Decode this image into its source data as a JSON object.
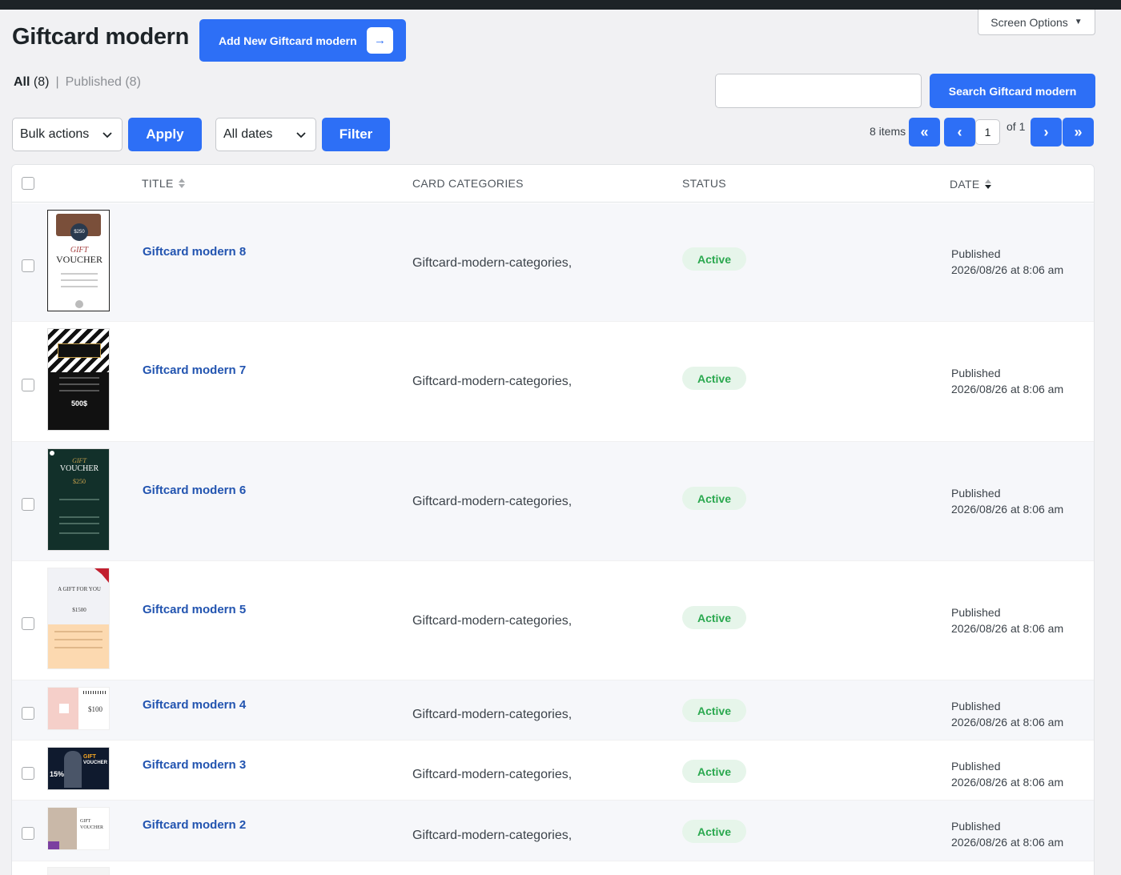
{
  "page": {
    "title": "Giftcard modern",
    "add_new_label": "Add New Giftcard modern",
    "screen_options_label": "Screen Options"
  },
  "views": {
    "all_label": "All",
    "all_count": "(8)",
    "separator": "|",
    "published_label": "Published (8)"
  },
  "search": {
    "value": "",
    "button_label": "Search Giftcard modern"
  },
  "toolbar": {
    "bulk_actions_label": "Bulk actions",
    "apply_label": "Apply",
    "dates_label": "All dates",
    "filter_label": "Filter"
  },
  "pagination": {
    "items_label": "8 items",
    "first": "«",
    "prev": "‹",
    "current_page": "1",
    "of_label": "of 1",
    "next": "›",
    "last": "»"
  },
  "table": {
    "columns": [
      "TITLE",
      "CARD CATEGORIES",
      "STATUS",
      "DATE"
    ],
    "rows": [
      {
        "title": "Giftcard modern 8",
        "category": "Giftcard-modern-categories,",
        "status": "Active",
        "date_status": "Published",
        "date": "2026/08/26 at 8:06 am"
      },
      {
        "title": "Giftcard modern 7",
        "category": "Giftcard-modern-categories,",
        "status": "Active",
        "date_status": "Published",
        "date": "2026/08/26 at 8:06 am"
      },
      {
        "title": "Giftcard modern 6",
        "category": "Giftcard-modern-categories,",
        "status": "Active",
        "date_status": "Published",
        "date": "2026/08/26 at 8:06 am"
      },
      {
        "title": "Giftcard modern 5",
        "category": "Giftcard-modern-categories,",
        "status": "Active",
        "date_status": "Published",
        "date": "2026/08/26 at 8:06 am"
      },
      {
        "title": "Giftcard modern 4",
        "category": "Giftcard-modern-categories,",
        "status": "Active",
        "date_status": "Published",
        "date": "2026/08/26 at 8:06 am"
      },
      {
        "title": "Giftcard modern 3",
        "category": "Giftcard-modern-categories,",
        "status": "Active",
        "date_status": "Published",
        "date": "2026/08/26 at 8:06 am"
      },
      {
        "title": "Giftcard modern 2",
        "category": "Giftcard-modern-categories,",
        "status": "Active",
        "date_status": "Published",
        "date": "2026/08/26 at 8:06 am"
      }
    ]
  },
  "thumbnails": {
    "t8_title": "GIFT",
    "t8_word": "VOUCHER",
    "t8_price": "$250",
    "t7_price": "500$",
    "t6_title": "GIFT",
    "t6_word": "VOUCHER",
    "t6_price": "$250",
    "t5_title": "A GIFT FOR YOU",
    "t5_price": "$1500",
    "t4_price": "$100",
    "t3_pct": "15%",
    "t3_title": "GIFT",
    "t3_word": "VOUCHER",
    "t2_title": "GIFT",
    "t2_word": "VOUCHER"
  },
  "colors": {
    "accent": "#2d6ff6",
    "title_link": "#2254b0",
    "status_bg": "#e6f5ea",
    "status_text": "#2aa84f",
    "admin_bar": "#1d2327"
  }
}
